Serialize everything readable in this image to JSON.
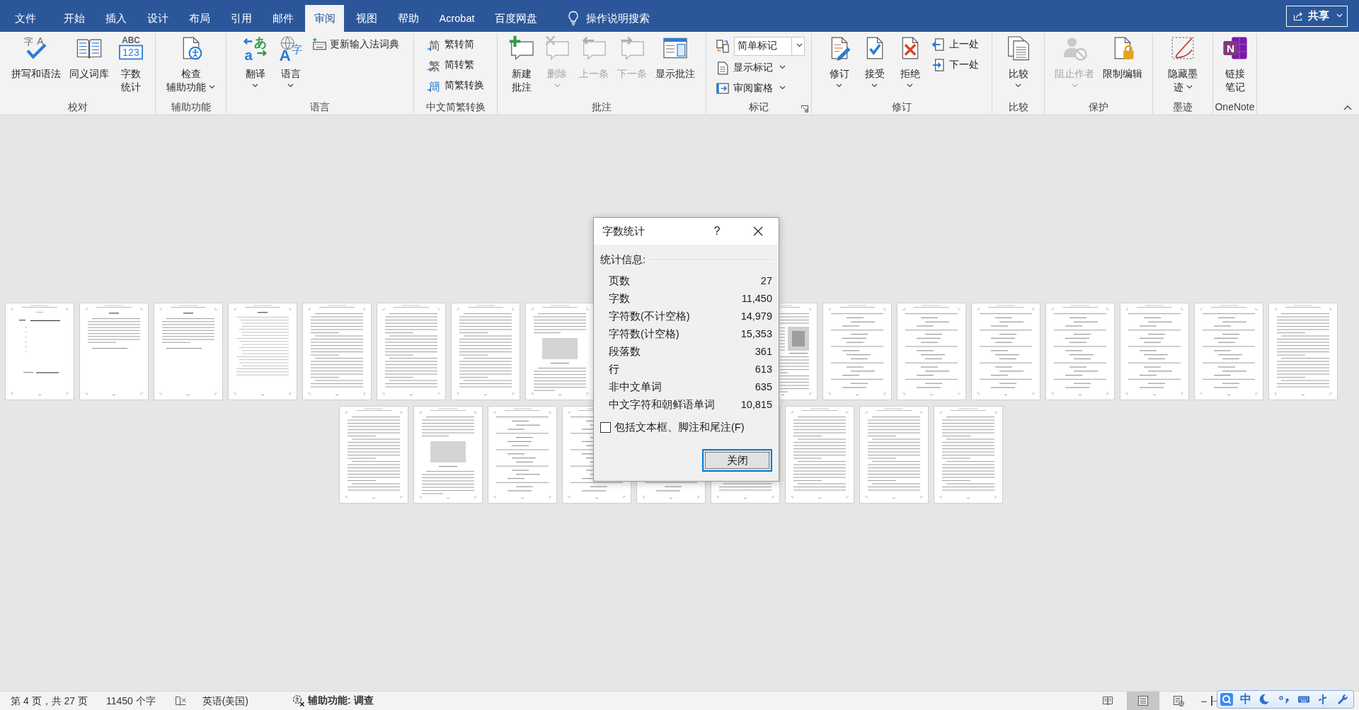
{
  "title_bar": {
    "tabs": [
      {
        "label": "文件",
        "selected": false
      },
      {
        "label": "开始",
        "selected": false
      },
      {
        "label": "插入",
        "selected": false
      },
      {
        "label": "设计",
        "selected": false
      },
      {
        "label": "布局",
        "selected": false
      },
      {
        "label": "引用",
        "selected": false
      },
      {
        "label": "邮件",
        "selected": false
      },
      {
        "label": "审阅",
        "selected": true
      },
      {
        "label": "视图",
        "selected": false
      },
      {
        "label": "帮助",
        "selected": false
      },
      {
        "label": "Acrobat",
        "selected": false
      },
      {
        "label": "百度网盘",
        "selected": false
      }
    ],
    "tell_me": "操作说明搜索",
    "share": "共享"
  },
  "ribbon": {
    "groups": [
      {
        "label": "校对",
        "launcher": false,
        "items": [
          {
            "kind": "large",
            "lines": [
              "拼写和语法"
            ],
            "icon_text": [
              "字",
              "A"
            ],
            "dropdown": false,
            "disabled": false
          },
          {
            "kind": "large",
            "lines": [
              "同义词库"
            ],
            "dropdown": false,
            "disabled": false
          },
          {
            "kind": "large",
            "lines": [
              "字数",
              "统计"
            ],
            "icon_text": [
              "ABC",
              "123"
            ],
            "dropdown": false,
            "disabled": false
          }
        ]
      },
      {
        "label": "辅助功能",
        "launcher": false,
        "items": [
          {
            "kind": "large",
            "lines": [
              "检查",
              "辅助功能"
            ],
            "dropdown": true,
            "disabled": false
          }
        ]
      },
      {
        "label": "语言",
        "launcher": false,
        "items": [
          {
            "kind": "large",
            "lines": [
              "翻译"
            ],
            "icon_text": [
              "あ",
              "a"
            ],
            "dropdown": true,
            "disabled": false
          },
          {
            "kind": "large",
            "lines": [
              "语言"
            ],
            "icon_text": [
              "A",
              "字"
            ],
            "dropdown": true,
            "disabled": false
          },
          {
            "kind": "small",
            "label": "更新输入法词典",
            "dropdown": false,
            "disabled": false
          }
        ]
      },
      {
        "label": "中文简繁转换",
        "launcher": false,
        "items": [
          {
            "kind": "small",
            "label": "繁转简",
            "icon_text": [
              "简"
            ],
            "dropdown": false,
            "disabled": false
          },
          {
            "kind": "small",
            "label": "简转繁",
            "icon_text": [
              "繁"
            ],
            "dropdown": false,
            "disabled": false
          },
          {
            "kind": "small",
            "label": "简繁转换",
            "icon_text": [
              "簡"
            ],
            "dropdown": false,
            "disabled": false
          }
        ]
      },
      {
        "label": "批注",
        "launcher": false,
        "items": [
          {
            "kind": "large",
            "lines": [
              "新建",
              "批注"
            ],
            "dropdown": false,
            "disabled": false
          },
          {
            "kind": "large",
            "lines": [
              "删除"
            ],
            "dropdown": true,
            "disabled": true
          },
          {
            "kind": "large",
            "lines": [
              "上一条"
            ],
            "dropdown": false,
            "disabled": true
          },
          {
            "kind": "large",
            "lines": [
              "下一条"
            ],
            "dropdown": false,
            "disabled": true
          },
          {
            "kind": "large",
            "lines": [
              "显示批注"
            ],
            "dropdown": false,
            "disabled": false
          }
        ]
      },
      {
        "label": "标记",
        "launcher": true,
        "items": [
          {
            "kind": "combo",
            "value": "简单标记",
            "disabled": false
          },
          {
            "kind": "small",
            "label": "显示标记",
            "dropdown": true,
            "disabled": false
          },
          {
            "kind": "small",
            "label": "审阅窗格",
            "dropdown": true,
            "disabled": false
          }
        ]
      },
      {
        "label": "修订",
        "launcher": false,
        "items": [
          {
            "kind": "large",
            "lines": [
              "修订"
            ],
            "dropdown": true,
            "disabled": false
          },
          {
            "kind": "large",
            "lines": [
              "接受"
            ],
            "dropdown": true,
            "disabled": false
          },
          {
            "kind": "large",
            "lines": [
              "拒绝"
            ],
            "dropdown": true,
            "disabled": false
          },
          {
            "kind": "small",
            "label": "上一处",
            "dropdown": false,
            "disabled": false
          },
          {
            "kind": "small",
            "label": "下一处",
            "dropdown": false,
            "disabled": false
          }
        ]
      },
      {
        "label": "比较",
        "launcher": false,
        "items": [
          {
            "kind": "large",
            "lines": [
              "比较"
            ],
            "dropdown": true,
            "disabled": false
          }
        ]
      },
      {
        "label": "保护",
        "launcher": false,
        "items": [
          {
            "kind": "large",
            "lines": [
              "阻止作者"
            ],
            "dropdown": true,
            "disabled": true
          },
          {
            "kind": "large",
            "lines": [
              "限制编辑"
            ],
            "dropdown": false,
            "disabled": false
          }
        ]
      },
      {
        "label": "墨迹",
        "launcher": false,
        "items": [
          {
            "kind": "large",
            "lines": [
              "隐藏墨",
              "迹"
            ],
            "dropdown": true,
            "disabled": false
          }
        ]
      },
      {
        "label": "OneNote",
        "launcher": false,
        "items": [
          {
            "kind": "large",
            "lines": [
              "链接",
              "笔记"
            ],
            "icon_text": [
              "N"
            ],
            "dropdown": false,
            "disabled": false
          }
        ]
      }
    ]
  },
  "document": {
    "page_rows": [
      {
        "pages": [
          {
            "kind": "cover"
          },
          {
            "kind": "abstract"
          },
          {
            "kind": "abstract"
          },
          {
            "kind": "toc"
          },
          {
            "kind": "text"
          },
          {
            "kind": "text"
          },
          {
            "kind": "text"
          },
          {
            "kind": "figure"
          },
          {
            "kind": "figure_right"
          },
          {
            "kind": "equations"
          },
          {
            "kind": "equations"
          },
          {
            "kind": "equations"
          },
          {
            "kind": "equations"
          },
          {
            "kind": "equations"
          },
          {
            "kind": "equations"
          },
          {
            "kind": "text"
          }
        ]
      },
      {
        "pages": [
          {
            "kind": "text"
          },
          {
            "kind": "figure"
          },
          {
            "kind": "equations"
          },
          {
            "kind": "equations"
          },
          {
            "kind": "equations"
          },
          {
            "kind": "text"
          },
          {
            "kind": "text"
          },
          {
            "kind": "text"
          },
          {
            "kind": "text"
          }
        ]
      }
    ]
  },
  "dialog": {
    "title": "字数统计",
    "help": "?",
    "section": "统计信息:",
    "stats": [
      {
        "label": "页数",
        "value": "27"
      },
      {
        "label": "字数",
        "value": "11,450"
      },
      {
        "label": "字符数(不计空格)",
        "value": "14,979"
      },
      {
        "label": "字符数(计空格)",
        "value": "15,353"
      },
      {
        "label": "段落数",
        "value": "361"
      },
      {
        "label": "行",
        "value": "613"
      },
      {
        "label": "非中文单词",
        "value": "635"
      },
      {
        "label": "中文字符和朝鲜语单词",
        "value": "10,815"
      }
    ],
    "checkbox": {
      "label": "包括文本框、脚注和尾注(F)",
      "checked": false
    },
    "close_button": "关闭"
  },
  "status_bar": {
    "items": [
      {
        "kind": "page",
        "label": "第 4 页，共 27 页"
      },
      {
        "kind": "words",
        "label": "11450 个字"
      },
      {
        "kind": "proofing"
      },
      {
        "kind": "language",
        "label": "英语(美国)"
      },
      {
        "kind": "accessibility",
        "label": "辅助功能: 调查"
      }
    ],
    "views": [
      {
        "selected": false
      },
      {
        "selected": true
      },
      {
        "selected": false
      }
    ],
    "zoom_out": "−"
  },
  "ime_toolbar": {
    "mode": "中"
  }
}
